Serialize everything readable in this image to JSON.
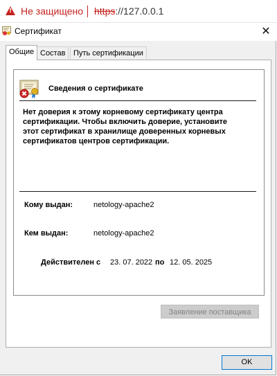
{
  "browser": {
    "security_status": "Не защищено",
    "url_scheme": "https",
    "url_rest": "://127.0.0.1"
  },
  "dialog": {
    "title": "Сертификат",
    "close_symbol": "✕"
  },
  "tabs": [
    {
      "label": "Общие",
      "active": true
    },
    {
      "label": "Состав",
      "active": false
    },
    {
      "label": "Путь сертификации",
      "active": false
    }
  ],
  "info": {
    "heading": "Сведения о сертификате",
    "trust_message": "Нет доверия к этому корневому сертификату центра сертификации. Чтобы включить  доверие, установите этот сертификат в хранилище доверенных корневых сертификатов центров сертификации."
  },
  "issued_to": {
    "label": "Кому выдан:",
    "value": "netology-apache2"
  },
  "issued_by": {
    "label": "Кем выдан:",
    "value": "netology-apache2"
  },
  "validity": {
    "label": "Действителен с",
    "from": "23. 07. 2022",
    "to_label": "по",
    "to": "12. 05. 2025"
  },
  "buttons": {
    "issuer_statement": "Заявление поставщика",
    "ok": "OK"
  },
  "colors": {
    "warning_red": "#c5221f",
    "focus_blue": "#0078d7",
    "disabled_gray": "#cccccc"
  }
}
